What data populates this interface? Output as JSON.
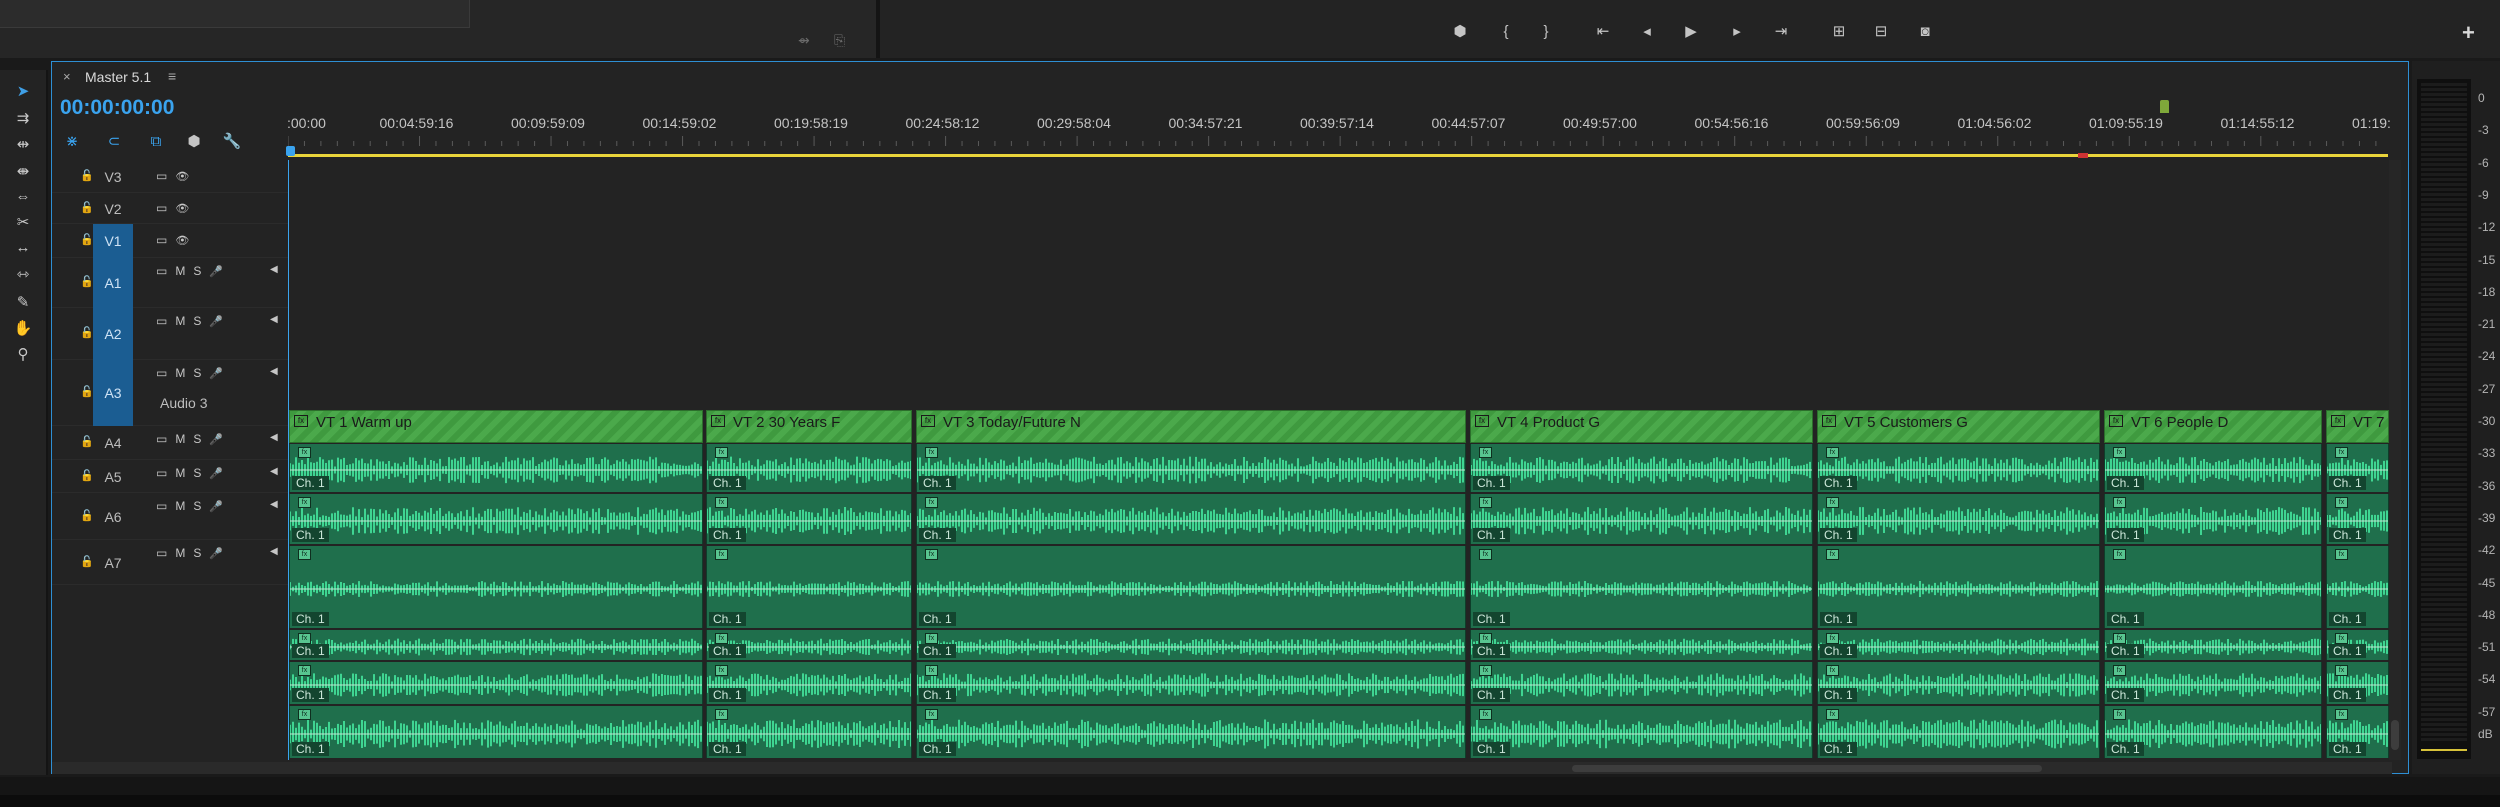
{
  "top": {
    "transport": [
      {
        "name": "add-marker-icon",
        "glyph": "⬢"
      },
      {
        "name": "mark-in-icon",
        "glyph": "{"
      },
      {
        "name": "mark-out-icon",
        "glyph": "}"
      },
      {
        "name": "go-to-in-icon",
        "glyph": "⇤"
      },
      {
        "name": "step-back-icon",
        "glyph": "◂"
      },
      {
        "name": "play-icon",
        "glyph": "▶"
      },
      {
        "name": "step-forward-icon",
        "glyph": "▸"
      },
      {
        "name": "go-to-out-icon",
        "glyph": "⇥"
      },
      {
        "name": "lift-icon",
        "glyph": "⊞"
      },
      {
        "name": "extract-icon",
        "glyph": "⊟"
      },
      {
        "name": "export-frame-icon",
        "glyph": "◙"
      }
    ],
    "plus": "+"
  },
  "tools": [
    {
      "name": "selection-tool-icon",
      "glyph": "➤",
      "active": true
    },
    {
      "name": "track-select-tool-icon",
      "glyph": "⇉"
    },
    {
      "name": "ripple-edit-tool-icon",
      "glyph": "⇹"
    },
    {
      "name": "rolling-edit-tool-icon",
      "glyph": "⇼"
    },
    {
      "name": "rate-stretch-tool-icon",
      "glyph": "⇔"
    },
    {
      "name": "razor-tool-icon",
      "glyph": "✂"
    },
    {
      "name": "slip-tool-icon",
      "glyph": "↔"
    },
    {
      "name": "slide-tool-icon",
      "glyph": "⇿"
    },
    {
      "name": "pen-tool-icon",
      "glyph": "✎"
    },
    {
      "name": "hand-tool-icon",
      "glyph": "✋"
    },
    {
      "name": "zoom-tool-icon",
      "glyph": "⚲"
    }
  ],
  "timeline": {
    "tab_close": "×",
    "tab_title": "Master 5.1",
    "tab_menu": "≡",
    "timecode": "00:00:00:00",
    "ruler_labels": [
      ":00:00",
      "00:04:59:16",
      "00:09:59:09",
      "00:14:59:02",
      "00:19:58:19",
      "00:24:58:12",
      "00:29:58:04",
      "00:34:57:21",
      "00:39:57:14",
      "00:44:57:07",
      "00:49:57:00",
      "00:54:56:16",
      "00:59:56:09",
      "01:04:56:02",
      "01:09:55:19",
      "01:14:55:12",
      "01:19:"
    ],
    "tracks": [
      {
        "name": "V3",
        "kind": "video"
      },
      {
        "name": "V2",
        "kind": "video"
      },
      {
        "name": "V1",
        "kind": "video",
        "selected": true
      },
      {
        "name": "A1",
        "kind": "audio",
        "selected": true
      },
      {
        "name": "A2",
        "kind": "audio",
        "selected": true
      },
      {
        "name": "A3",
        "kind": "audio",
        "selected": true,
        "sub": "Audio 3"
      },
      {
        "name": "A4",
        "kind": "audio"
      },
      {
        "name": "A5",
        "kind": "audio"
      },
      {
        "name": "A6",
        "kind": "audio"
      },
      {
        "name": "A7",
        "kind": "audio"
      }
    ],
    "audio_icons": {
      "sync": "▭",
      "mute": "M",
      "solo": "S",
      "mic": "🎙"
    },
    "video_clips": [
      "VT 1 Warm up",
      "VT 2 30 Years F",
      "VT 3 Today/Future N",
      "VT 4 Product G",
      "VT 5 Customers G",
      "VT 6 People D",
      "VT 7"
    ],
    "channel_label": "Ch. 1",
    "fx_label": "fx"
  },
  "meters": {
    "labels": [
      "0",
      "-3",
      "-6",
      "-9",
      "-12",
      "-15",
      "-18",
      "-21",
      "-24",
      "-27",
      "-30",
      "-33",
      "-36",
      "-39",
      "-42",
      "-45",
      "-48",
      "-51",
      "-54",
      "-57"
    ],
    "unit": "dB"
  },
  "colors": {
    "accent": "#3aa3ee",
    "video_clip": "#4ba94b",
    "audio_clip": "#1f6f4c",
    "waveform": "#3fd592",
    "work_area": "#e9d43b"
  }
}
